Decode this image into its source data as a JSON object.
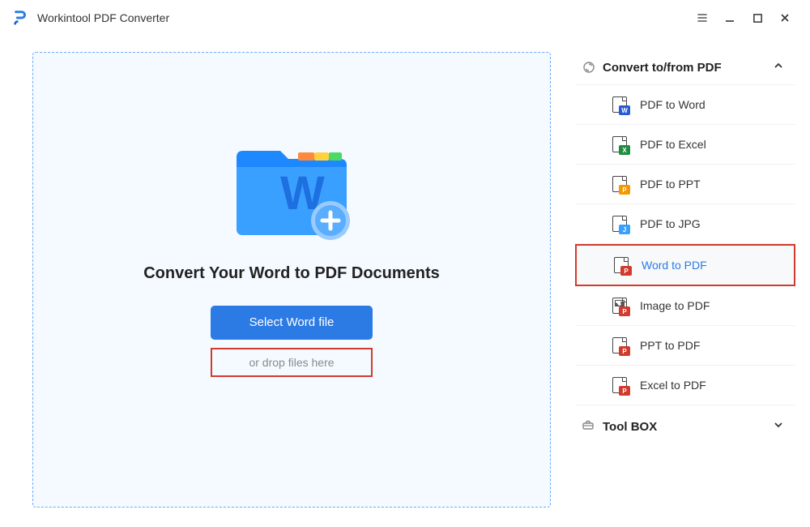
{
  "app": {
    "title": "Workintool PDF Converter"
  },
  "main": {
    "headline": "Convert Your Word to PDF Documents",
    "select_button": "Select Word file",
    "drop_hint": "or drop files here"
  },
  "sidebar": {
    "convert_header": "Convert to/from PDF",
    "items": [
      {
        "label": "PDF to Word"
      },
      {
        "label": "PDF to Excel"
      },
      {
        "label": "PDF to PPT"
      },
      {
        "label": "PDF to JPG"
      },
      {
        "label": "Word to PDF"
      },
      {
        "label": "Image to PDF"
      },
      {
        "label": "PPT to PDF"
      },
      {
        "label": "Excel to PDF"
      }
    ],
    "toolbox_header": "Tool BOX"
  }
}
